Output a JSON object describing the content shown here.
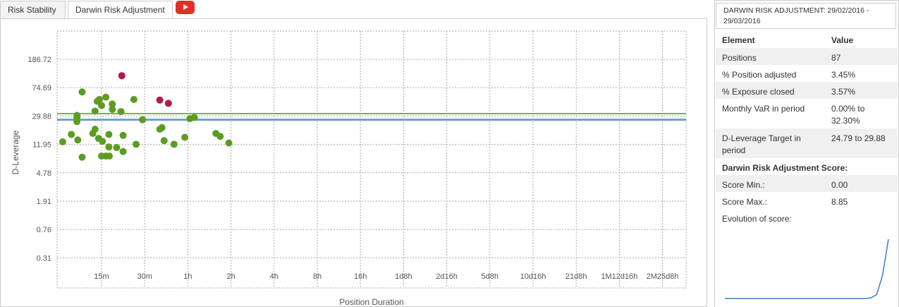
{
  "tabs": [
    "Risk Stability",
    "Darwin Risk Adjustment"
  ],
  "youtube_icon": "youtube-play-icon",
  "summary": {
    "period": "DARWIN RISK ADJUSTMENT: 29/02/2016 - 29/03/2016",
    "header": {
      "element": "Element",
      "value": "Value"
    },
    "rows": [
      {
        "label": "Positions",
        "value": "87"
      },
      {
        "label": "% Position adjusted",
        "value": "3.45%"
      },
      {
        "label": "% Exposure closed",
        "value": "3.57%"
      },
      {
        "label": "Monthly VaR in period",
        "value": "0.00% to 32.30%"
      },
      {
        "label": "D-Leverage Target in period",
        "value": "24.79 to 29.88"
      }
    ],
    "score_title": "Darwin Risk Adjustment Score:",
    "score_min_label": "Score Min.:",
    "score_min": "0.00",
    "score_max_label": "Score Max.:",
    "score_max": "8.85",
    "evolution_label": "Evolution of score:",
    "evolution": [
      0,
      0,
      0,
      0,
      0,
      0,
      0,
      0,
      0,
      0,
      0,
      0,
      0,
      0,
      0,
      0,
      0,
      0,
      0,
      0,
      0,
      0,
      0,
      0,
      0,
      0.1,
      0.6,
      3.5,
      8.85
    ]
  },
  "colors": {
    "adjusted": "#b5174c",
    "normal": "#5c9c23",
    "upper_line": "#7cb342",
    "lower_line": "#6a9fd8",
    "sparkline": "#3a7dc9"
  },
  "chart_data": {
    "type": "scatter",
    "xlabel": "Position Duration",
    "ylabel": "D-Leverage",
    "y_scale": "log",
    "y_ticks": [
      "186.72",
      "74.69",
      "29.88",
      "11.95",
      "4.78",
      "1.91",
      "0.76",
      "0.31"
    ],
    "x_ticks": [
      "15m",
      "30m",
      "1h",
      "2h",
      "4h",
      "8h",
      "16h",
      "1d8h",
      "2d16h",
      "5d8h",
      "10d16h",
      "21d8h",
      "1M12d16h",
      "2M25d8h"
    ],
    "x_range_index": [
      -0.95,
      14.2
    ],
    "grid": true,
    "legend": "none",
    "reference_lines": [
      {
        "name": "upper",
        "y": 32.3
      },
      {
        "name": "lower",
        "y": 26.5
      }
    ],
    "series": [
      {
        "category": "normal",
        "points": [
          {
            "x": -0.9,
            "y": 13.0
          },
          {
            "x": -0.7,
            "y": 16.5
          },
          {
            "x": -0.57,
            "y": 28.5
          },
          {
            "x": -0.57,
            "y": 25.0
          },
          {
            "x": -0.55,
            "y": 13.8
          },
          {
            "x": -0.57,
            "y": 30.5
          },
          {
            "x": -0.45,
            "y": 65.0
          },
          {
            "x": -0.45,
            "y": 7.9
          },
          {
            "x": -0.2,
            "y": 17.0
          },
          {
            "x": -0.15,
            "y": 35.0
          },
          {
            "x": -0.15,
            "y": 19.5
          },
          {
            "x": -0.1,
            "y": 48.0
          },
          {
            "x": -0.07,
            "y": 14.5
          },
          {
            "x": -0.05,
            "y": 51.0
          },
          {
            "x": 0.0,
            "y": 42.0
          },
          {
            "x": 0.02,
            "y": 13.2
          },
          {
            "x": 0.0,
            "y": 8.2
          },
          {
            "x": 0.1,
            "y": 8.2
          },
          {
            "x": 0.1,
            "y": 55.0
          },
          {
            "x": 0.17,
            "y": 11.0
          },
          {
            "x": 0.17,
            "y": 16.5
          },
          {
            "x": 0.18,
            "y": 8.2
          },
          {
            "x": 0.25,
            "y": 44.0
          },
          {
            "x": 0.25,
            "y": 37.0
          },
          {
            "x": 0.35,
            "y": 10.8
          },
          {
            "x": 0.45,
            "y": 34.5
          },
          {
            "x": 0.5,
            "y": 16.0
          },
          {
            "x": 0.5,
            "y": 9.5
          },
          {
            "x": 0.75,
            "y": 51.0
          },
          {
            "x": 0.8,
            "y": 12.0
          },
          {
            "x": 0.95,
            "y": 26.5
          },
          {
            "x": 1.35,
            "y": 19.5
          },
          {
            "x": 1.4,
            "y": 20.5
          },
          {
            "x": 1.45,
            "y": 13.5
          },
          {
            "x": 1.68,
            "y": 12.0
          },
          {
            "x": 1.93,
            "y": 15.0
          },
          {
            "x": 2.05,
            "y": 27.5
          },
          {
            "x": 2.15,
            "y": 28.5
          },
          {
            "x": 2.65,
            "y": 17.0
          },
          {
            "x": 2.75,
            "y": 15.5
          },
          {
            "x": 2.95,
            "y": 12.5
          }
        ]
      },
      {
        "category": "adjusted",
        "points": [
          {
            "x": 0.47,
            "y": 110.0
          },
          {
            "x": 1.35,
            "y": 50.0
          },
          {
            "x": 1.55,
            "y": 45.0
          }
        ]
      }
    ]
  }
}
